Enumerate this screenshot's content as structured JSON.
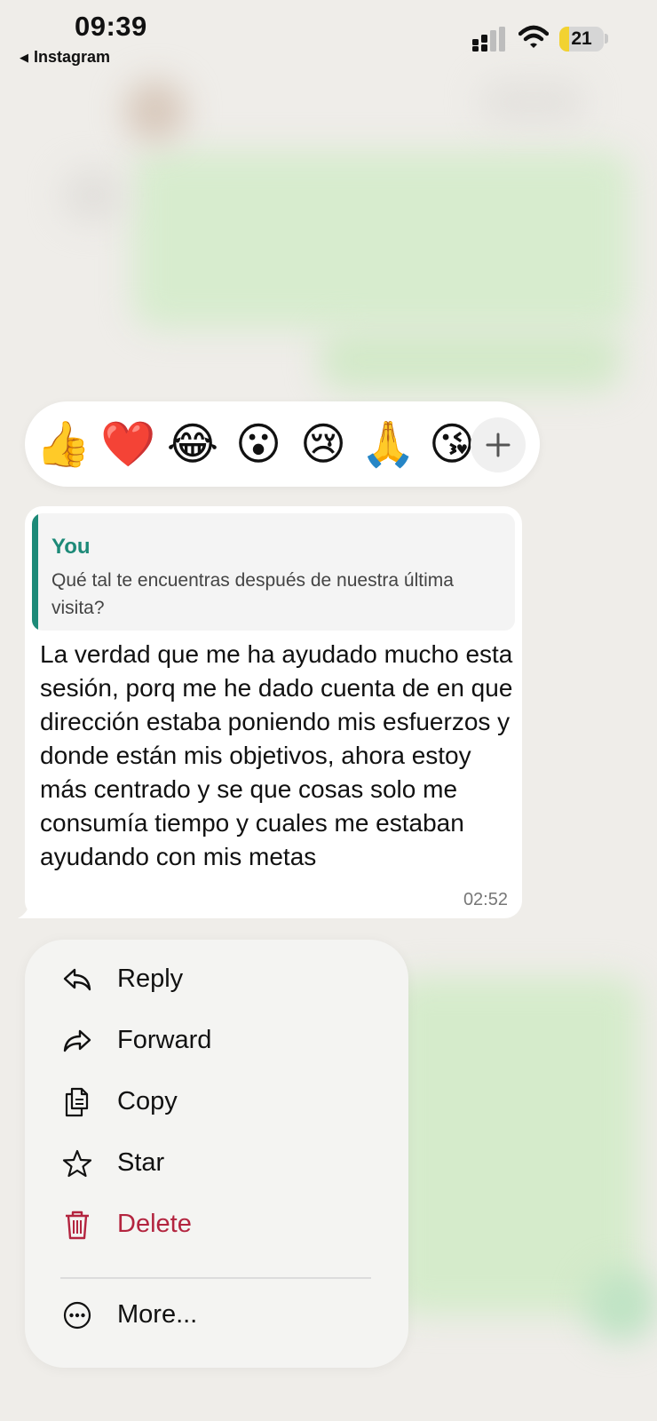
{
  "status_bar": {
    "time": "09:39",
    "back_app": "Instagram",
    "battery": "21",
    "battery_level": 0.21
  },
  "reactions": {
    "emojis": [
      {
        "char": "👍",
        "name": "thumbs-up"
      },
      {
        "char": "❤️",
        "name": "red-heart"
      },
      {
        "char": "😂",
        "name": "tears-of-joy"
      },
      {
        "char": "😮",
        "name": "surprised"
      },
      {
        "char": "😢",
        "name": "crying"
      },
      {
        "char": "🙏",
        "name": "folded-hands"
      },
      {
        "char": "😘",
        "name": "kiss"
      }
    ],
    "more_icon": "plus-icon"
  },
  "message": {
    "quote_author": "You",
    "quote_text": "Qué tal te encuentras después de nuestra última visita?",
    "text": "La verdad que me ha ayudado mucho esta sesión, porq me he dado cuenta de en que dirección estaba poniendo mis esfuerzos y donde están mis objetivos, ahora estoy más centrado y se que cosas solo me consumía tiempo y cuales me estaban ayudando con mis metas",
    "time": "02:52"
  },
  "menu": {
    "reply": "Reply",
    "forward": "Forward",
    "copy": "Copy",
    "star": "Star",
    "delete": "Delete",
    "more": "More..."
  },
  "colors": {
    "accent": "#1d8a78",
    "danger": "#b3243f",
    "battery": "#f2d230"
  }
}
